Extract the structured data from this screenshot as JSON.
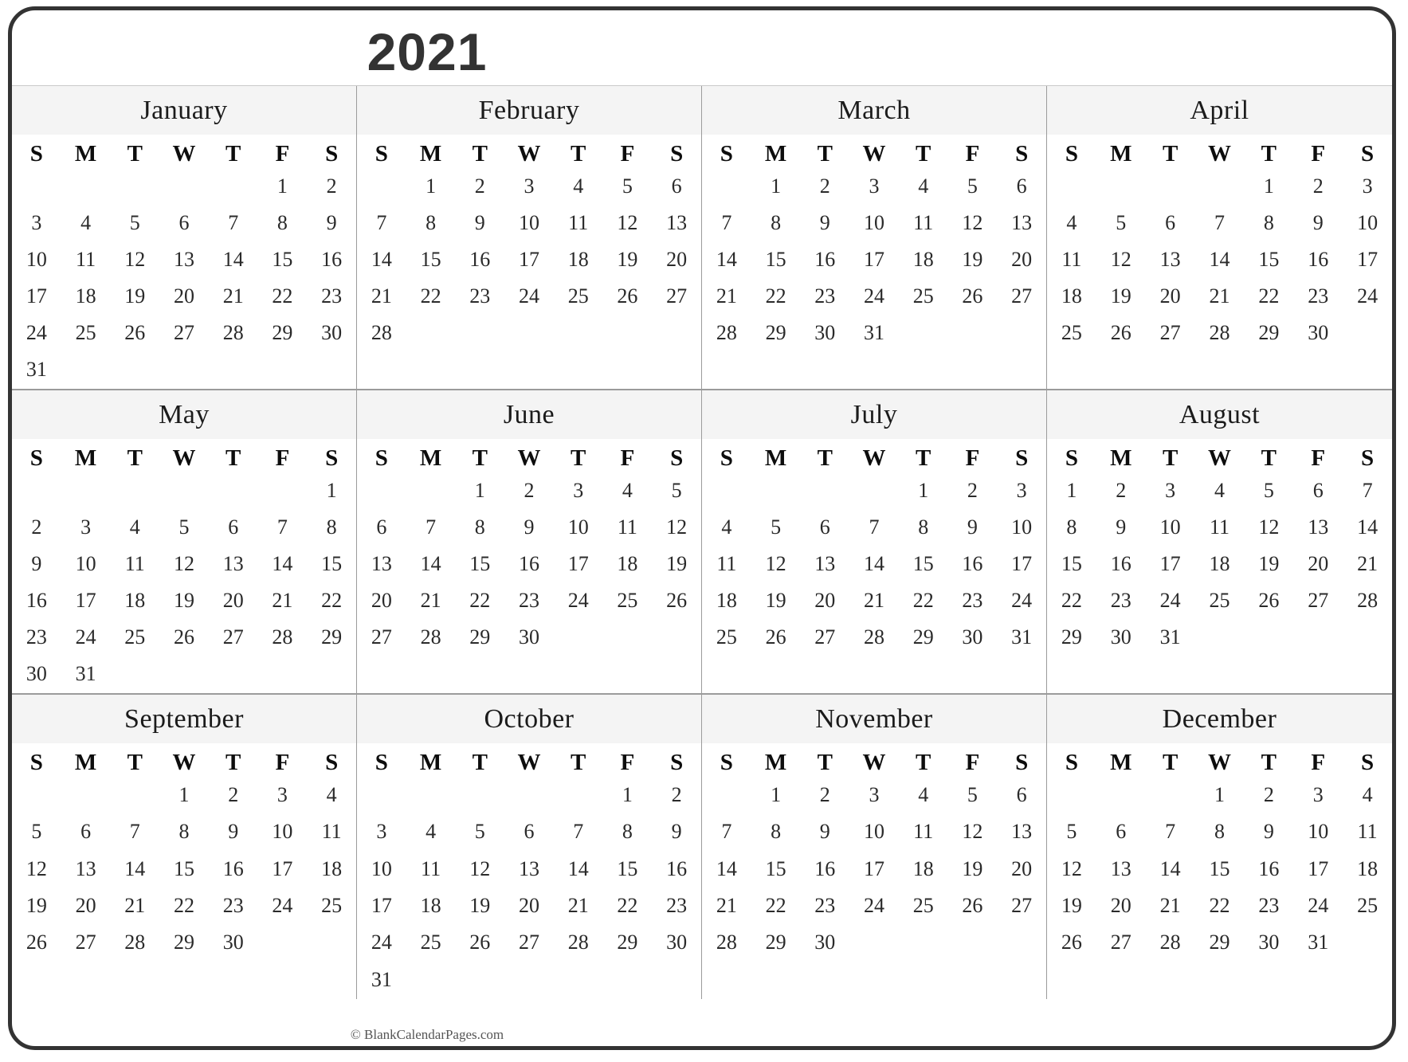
{
  "title": "2021",
  "footer": "© BlankCalendarPages.com",
  "colors": {
    "border": "#333333",
    "month_header_bg": "#f4f4f4",
    "grid_line": "#9b9b9b",
    "title": "#333333",
    "day_text": "#2a2a2a"
  },
  "daynames": [
    "S",
    "M",
    "T",
    "W",
    "T",
    "F",
    "S"
  ],
  "months": [
    {
      "name": "January",
      "first_weekday": 5,
      "num_days": 31,
      "weeks": [
        [
          "",
          "",
          "",
          "",
          "",
          "1",
          "2"
        ],
        [
          "3",
          "4",
          "5",
          "6",
          "7",
          "8",
          "9"
        ],
        [
          "10",
          "11",
          "12",
          "13",
          "14",
          "15",
          "16"
        ],
        [
          "17",
          "18",
          "19",
          "20",
          "21",
          "22",
          "23"
        ],
        [
          "24",
          "25",
          "26",
          "27",
          "28",
          "29",
          "30"
        ],
        [
          "31",
          "",
          "",
          "",
          "",
          "",
          ""
        ]
      ]
    },
    {
      "name": "February",
      "first_weekday": 1,
      "num_days": 28,
      "weeks": [
        [
          "",
          "1",
          "2",
          "3",
          "4",
          "5",
          "6"
        ],
        [
          "7",
          "8",
          "9",
          "10",
          "11",
          "12",
          "13"
        ],
        [
          "14",
          "15",
          "16",
          "17",
          "18",
          "19",
          "20"
        ],
        [
          "21",
          "22",
          "23",
          "24",
          "25",
          "26",
          "27"
        ],
        [
          "28",
          "",
          "",
          "",
          "",
          "",
          ""
        ],
        [
          "",
          "",
          "",
          "",
          "",
          "",
          ""
        ]
      ]
    },
    {
      "name": "March",
      "first_weekday": 1,
      "num_days": 31,
      "weeks": [
        [
          "",
          "1",
          "2",
          "3",
          "4",
          "5",
          "6"
        ],
        [
          "7",
          "8",
          "9",
          "10",
          "11",
          "12",
          "13"
        ],
        [
          "14",
          "15",
          "16",
          "17",
          "18",
          "19",
          "20"
        ],
        [
          "21",
          "22",
          "23",
          "24",
          "25",
          "26",
          "27"
        ],
        [
          "28",
          "29",
          "30",
          "31",
          "",
          "",
          ""
        ],
        [
          "",
          "",
          "",
          "",
          "",
          "",
          ""
        ]
      ]
    },
    {
      "name": "April",
      "first_weekday": 4,
      "num_days": 30,
      "weeks": [
        [
          "",
          "",
          "",
          "",
          "1",
          "2",
          "3"
        ],
        [
          "4",
          "5",
          "6",
          "7",
          "8",
          "9",
          "10"
        ],
        [
          "11",
          "12",
          "13",
          "14",
          "15",
          "16",
          "17"
        ],
        [
          "18",
          "19",
          "20",
          "21",
          "22",
          "23",
          "24"
        ],
        [
          "25",
          "26",
          "27",
          "28",
          "29",
          "30",
          ""
        ],
        [
          "",
          "",
          "",
          "",
          "",
          "",
          ""
        ]
      ]
    },
    {
      "name": "May",
      "first_weekday": 6,
      "num_days": 31,
      "weeks": [
        [
          "",
          "",
          "",
          "",
          "",
          "",
          "1"
        ],
        [
          "2",
          "3",
          "4",
          "5",
          "6",
          "7",
          "8"
        ],
        [
          "9",
          "10",
          "11",
          "12",
          "13",
          "14",
          "15"
        ],
        [
          "16",
          "17",
          "18",
          "19",
          "20",
          "21",
          "22"
        ],
        [
          "23",
          "24",
          "25",
          "26",
          "27",
          "28",
          "29"
        ],
        [
          "30",
          "31",
          "",
          "",
          "",
          "",
          ""
        ]
      ]
    },
    {
      "name": "June",
      "first_weekday": 2,
      "num_days": 30,
      "weeks": [
        [
          "",
          "",
          "1",
          "2",
          "3",
          "4",
          "5"
        ],
        [
          "6",
          "7",
          "8",
          "9",
          "10",
          "11",
          "12"
        ],
        [
          "13",
          "14",
          "15",
          "16",
          "17",
          "18",
          "19"
        ],
        [
          "20",
          "21",
          "22",
          "23",
          "24",
          "25",
          "26"
        ],
        [
          "27",
          "28",
          "29",
          "30",
          "",
          "",
          ""
        ],
        [
          "",
          "",
          "",
          "",
          "",
          "",
          ""
        ]
      ]
    },
    {
      "name": "July",
      "first_weekday": 4,
      "num_days": 31,
      "weeks": [
        [
          "",
          "",
          "",
          "",
          "1",
          "2",
          "3"
        ],
        [
          "4",
          "5",
          "6",
          "7",
          "8",
          "9",
          "10"
        ],
        [
          "11",
          "12",
          "13",
          "14",
          "15",
          "16",
          "17"
        ],
        [
          "18",
          "19",
          "20",
          "21",
          "22",
          "23",
          "24"
        ],
        [
          "25",
          "26",
          "27",
          "28",
          "29",
          "30",
          "31"
        ],
        [
          "",
          "",
          "",
          "",
          "",
          "",
          ""
        ]
      ]
    },
    {
      "name": "August",
      "first_weekday": 0,
      "num_days": 31,
      "weeks": [
        [
          "1",
          "2",
          "3",
          "4",
          "5",
          "6",
          "7"
        ],
        [
          "8",
          "9",
          "10",
          "11",
          "12",
          "13",
          "14"
        ],
        [
          "15",
          "16",
          "17",
          "18",
          "19",
          "20",
          "21"
        ],
        [
          "22",
          "23",
          "24",
          "25",
          "26",
          "27",
          "28"
        ],
        [
          "29",
          "30",
          "31",
          "",
          "",
          "",
          ""
        ],
        [
          "",
          "",
          "",
          "",
          "",
          "",
          ""
        ]
      ]
    },
    {
      "name": "September",
      "first_weekday": 3,
      "num_days": 30,
      "weeks": [
        [
          "",
          "",
          "",
          "1",
          "2",
          "3",
          "4"
        ],
        [
          "5",
          "6",
          "7",
          "8",
          "9",
          "10",
          "11"
        ],
        [
          "12",
          "13",
          "14",
          "15",
          "16",
          "17",
          "18"
        ],
        [
          "19",
          "20",
          "21",
          "22",
          "23",
          "24",
          "25"
        ],
        [
          "26",
          "27",
          "28",
          "29",
          "30",
          "",
          ""
        ],
        [
          "",
          "",
          "",
          "",
          "",
          "",
          ""
        ]
      ]
    },
    {
      "name": "October",
      "first_weekday": 5,
      "num_days": 31,
      "weeks": [
        [
          "",
          "",
          "",
          "",
          "",
          "1",
          "2"
        ],
        [
          "3",
          "4",
          "5",
          "6",
          "7",
          "8",
          "9"
        ],
        [
          "10",
          "11",
          "12",
          "13",
          "14",
          "15",
          "16"
        ],
        [
          "17",
          "18",
          "19",
          "20",
          "21",
          "22",
          "23"
        ],
        [
          "24",
          "25",
          "26",
          "27",
          "28",
          "29",
          "30"
        ],
        [
          "31",
          "",
          "",
          "",
          "",
          "",
          ""
        ]
      ]
    },
    {
      "name": "November",
      "first_weekday": 1,
      "num_days": 30,
      "weeks": [
        [
          "",
          "1",
          "2",
          "3",
          "4",
          "5",
          "6"
        ],
        [
          "7",
          "8",
          "9",
          "10",
          "11",
          "12",
          "13"
        ],
        [
          "14",
          "15",
          "16",
          "17",
          "18",
          "19",
          "20"
        ],
        [
          "21",
          "22",
          "23",
          "24",
          "25",
          "26",
          "27"
        ],
        [
          "28",
          "29",
          "30",
          "",
          "",
          "",
          ""
        ],
        [
          "",
          "",
          "",
          "",
          "",
          "",
          ""
        ]
      ]
    },
    {
      "name": "December",
      "first_weekday": 3,
      "num_days": 31,
      "weeks": [
        [
          "",
          "",
          "",
          "1",
          "2",
          "3",
          "4"
        ],
        [
          "5",
          "6",
          "7",
          "8",
          "9",
          "10",
          "11"
        ],
        [
          "12",
          "13",
          "14",
          "15",
          "16",
          "17",
          "18"
        ],
        [
          "19",
          "20",
          "21",
          "22",
          "23",
          "24",
          "25"
        ],
        [
          "26",
          "27",
          "28",
          "29",
          "30",
          "31",
          ""
        ],
        [
          "",
          "",
          "",
          "",
          "",
          "",
          ""
        ]
      ]
    }
  ]
}
